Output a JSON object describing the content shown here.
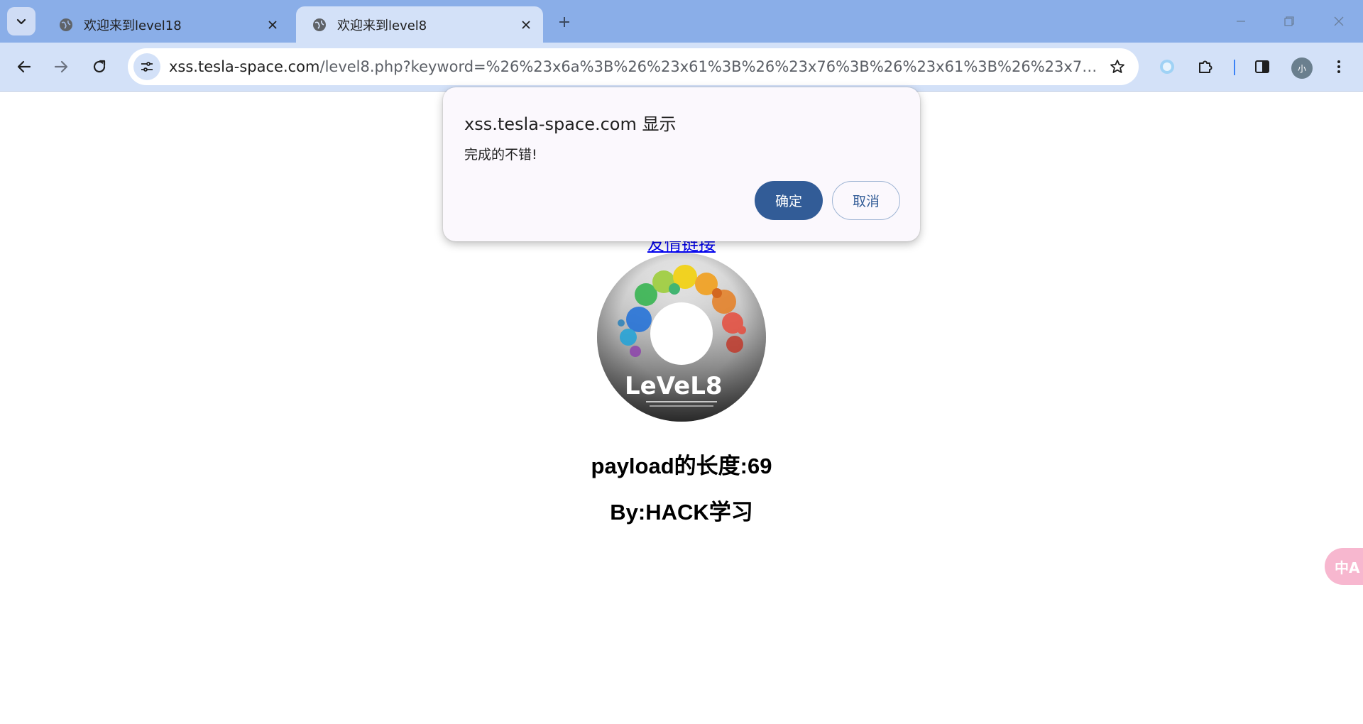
{
  "browser": {
    "tabs": [
      {
        "title": "欢迎来到level18",
        "active": false
      },
      {
        "title": "欢迎来到level8",
        "active": true
      }
    ],
    "address": {
      "host": "xss.tesla-space.com",
      "path": "/level8.php?keyword=%26%23x6a%3B%26%23x61%3B%26%23x76%3B%26%23x61%3B%26%23x73%3B%26..."
    },
    "profile_initial": "小"
  },
  "dialog": {
    "title": "xss.tesla-space.com 显示",
    "message": "完成的不错!",
    "ok_label": "确定",
    "cancel_label": "取消"
  },
  "page": {
    "friend_link": "友情链接",
    "disc_logo_text": "LeVeL8",
    "payload_length": "payload的长度:69",
    "byline": "By:HACK学习"
  },
  "translate_fab": "中A",
  "colors": {
    "tab_strip": "#8aaee8",
    "toolbar": "#d3e1f8",
    "dialog_ok": "#325c97",
    "link": "#0000ee"
  },
  "icons": [
    "tab-search-icon",
    "globe-icon",
    "close-icon",
    "plus-icon",
    "minimize-icon",
    "restore-icon",
    "window-close-icon",
    "back-icon",
    "forward-icon",
    "reload-icon",
    "tune-icon",
    "star-icon",
    "extension-icon",
    "puzzle-icon",
    "side-panel-icon",
    "more-icon"
  ]
}
